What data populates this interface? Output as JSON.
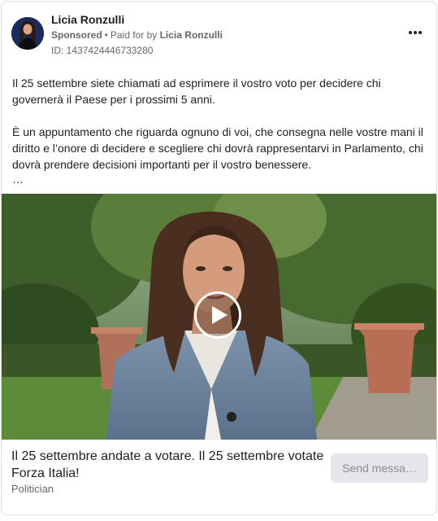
{
  "post": {
    "author": "Licia Ronzulli",
    "sponsored_label": "Sponsored",
    "separator": "•",
    "paid_for_prefix": "Paid for by",
    "paid_for_by": "Licia Ronzulli",
    "ad_id": "ID: 1437424446733280",
    "body_paragraph_1": "Il 25 settembre siete chiamati ad esprimere il vostro voto per decidere chi governerà il Paese per i prossimi 5 anni.",
    "body_paragraph_2": "È un appuntamento che riguarda ognuno di voi, che consegna nelle vostre mani il diritto e l’onore di decidere e scegliere chi dovrà rappresentarvi in Parlamento, chi dovrà prendere decisioni importanti per il vostro benessere.",
    "truncation": "…"
  },
  "footer": {
    "headline": "Il 25 settembre andate a votare. Il 25 settembre votate Forza Italia!",
    "category": "Politician",
    "cta_label": "Send messa…"
  },
  "icons": {
    "menu": "more-options-icon",
    "video": "play-icon"
  },
  "colors": {
    "text_primary": "#1c1e21",
    "text_secondary": "#65676b",
    "button_bg": "#e4e6eb"
  }
}
